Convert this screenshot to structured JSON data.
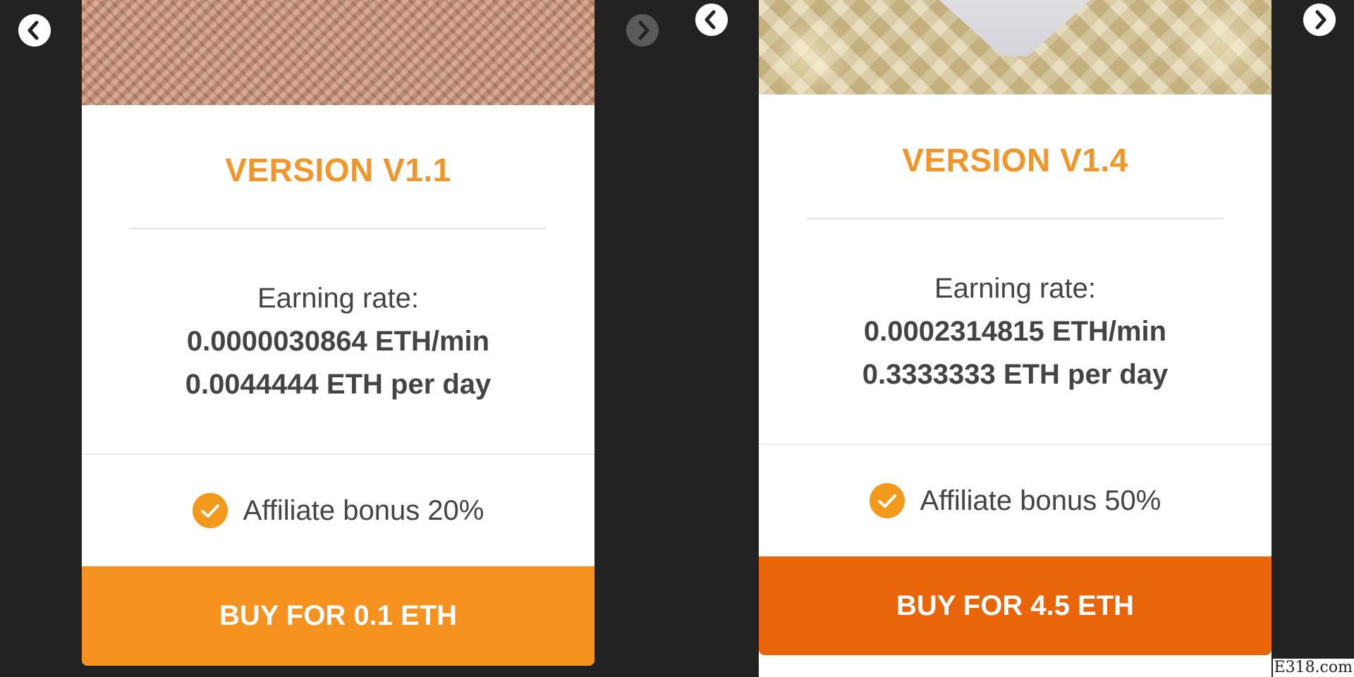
{
  "cards": [
    {
      "version_title": "VERSION V1.1",
      "earning_rate_label": "Earning rate:",
      "eth_per_min": "0.0000030864 ETH/min",
      "eth_per_day": "0.0044444 ETH per day",
      "affiliate_bonus": "Affiliate bonus 20%",
      "buy_button": "BUY FOR 0.1 ETH",
      "buy_button_color": "#f5921f"
    },
    {
      "version_title": "VERSION V1.4",
      "earning_rate_label": "Earning rate:",
      "eth_per_min": "0.0002314815 ETH/min",
      "eth_per_day": "0.3333333 ETH per day",
      "affiliate_bonus": "Affiliate bonus 50%",
      "buy_button": "BUY FOR 4.5 ETH",
      "buy_button_color": "#e8650a"
    }
  ],
  "navigation": {
    "left_panel": {
      "prev_icon": "chevron-left-icon",
      "next_icon": "chevron-right-icon"
    },
    "right_panel": {
      "prev_icon": "chevron-left-icon",
      "next_icon": "chevron-right-icon"
    }
  },
  "colors": {
    "accent_orange": "#f0962a",
    "check_icon": "#f39a1c",
    "background": "#222222",
    "text": "#444444"
  },
  "watermark": "E318.com"
}
